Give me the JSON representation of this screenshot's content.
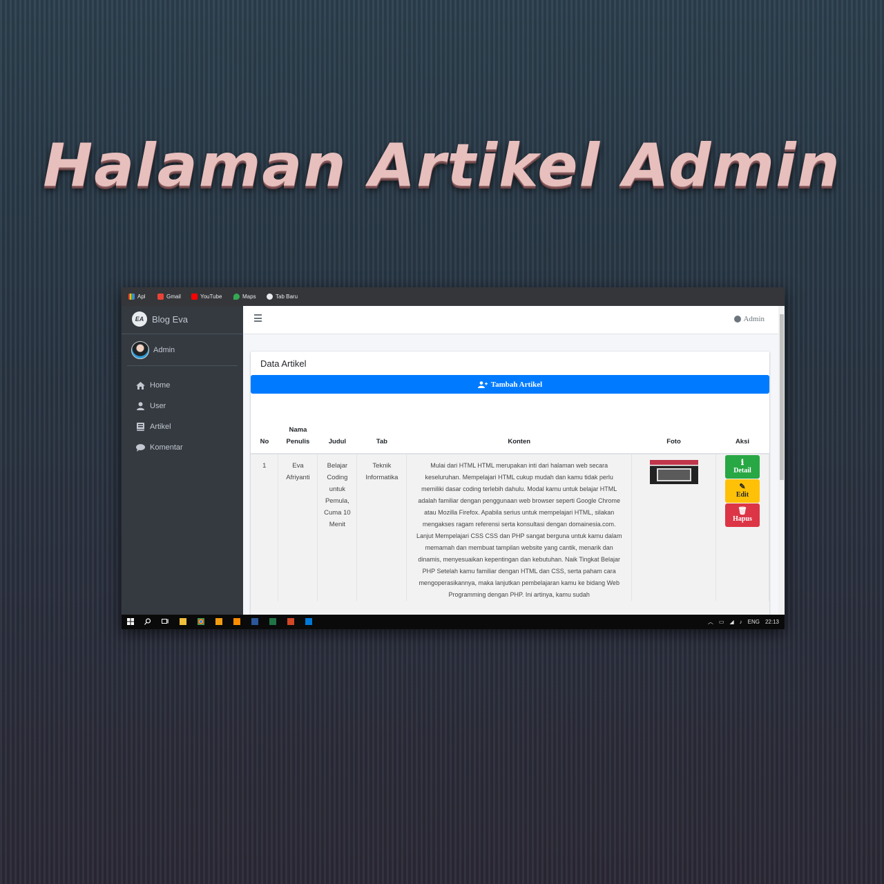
{
  "poster": {
    "title": "Halaman Artikel Admin"
  },
  "bookmarks": [
    "Apl",
    "Gmail",
    "YouTube",
    "Maps",
    "Tab Baru"
  ],
  "sidebar": {
    "brand": "Blog Eva",
    "brand_logo": "EA",
    "user": "Admin",
    "items": [
      {
        "label": "Home",
        "icon": "home-icon"
      },
      {
        "label": "User",
        "icon": "user-icon"
      },
      {
        "label": "Artikel",
        "icon": "book-icon"
      },
      {
        "label": "Komentar",
        "icon": "comment-icon"
      }
    ]
  },
  "topbar": {
    "admin_label": "Admin"
  },
  "card": {
    "title": "Data Artikel",
    "add_button": "Tambah Artikel"
  },
  "table": {
    "headers": {
      "no": "No",
      "penulis_1": "Nama",
      "penulis_2": "Penulis",
      "judul": "Judul",
      "tab": "Tab",
      "konten": "Konten",
      "foto": "Foto",
      "aksi": "Aksi"
    },
    "rows": [
      {
        "no": "1",
        "penulis": "Eva Afriyanti",
        "judul": "Belajar Coding untuk Pemula, Cuma 10 Menit",
        "tab": "Teknik Informatika",
        "konten": "Mulai dari HTML HTML merupakan inti dari halaman web secara keseluruhan. Mempelajari HTML cukup mudah dan kamu tidak perlu memiliki dasar coding terlebih dahulu. Modal kamu untuk belajar HTML adalah familiar dengan penggunaan web browser seperti Google Chrome atau Mozilla Firefox. Apabila serius untuk mempelajari HTML, silakan mengakses ragam referensi serta konsultasi dengan domainesia.com. Lanjut Mempelajari CSS CSS dan PHP sangat berguna untuk kamu dalam memamah dan membuat tampilan website yang cantik, menarik dan dinamis, menyesuaikan kepentingan dan kebutuhan. Naik Tingkat Belajar PHP Setelah kamu familiar dengan HTML dan CSS, serta paham cara mengoperasikannya, maka lanjutkan pembelajaran kamu ke bidang Web Programming dengan PHP. Ini artinya, kamu sudah"
      }
    ],
    "actions": {
      "detail": "Detail",
      "edit": "Edit",
      "hapus": "Hapus"
    }
  },
  "taskbar": {
    "lang": "ENG",
    "time": "22:13"
  },
  "colors": {
    "primary": "#007bff",
    "success": "#28a745",
    "warning": "#ffc107",
    "danger": "#dc3545",
    "sidebar": "#343a40"
  }
}
